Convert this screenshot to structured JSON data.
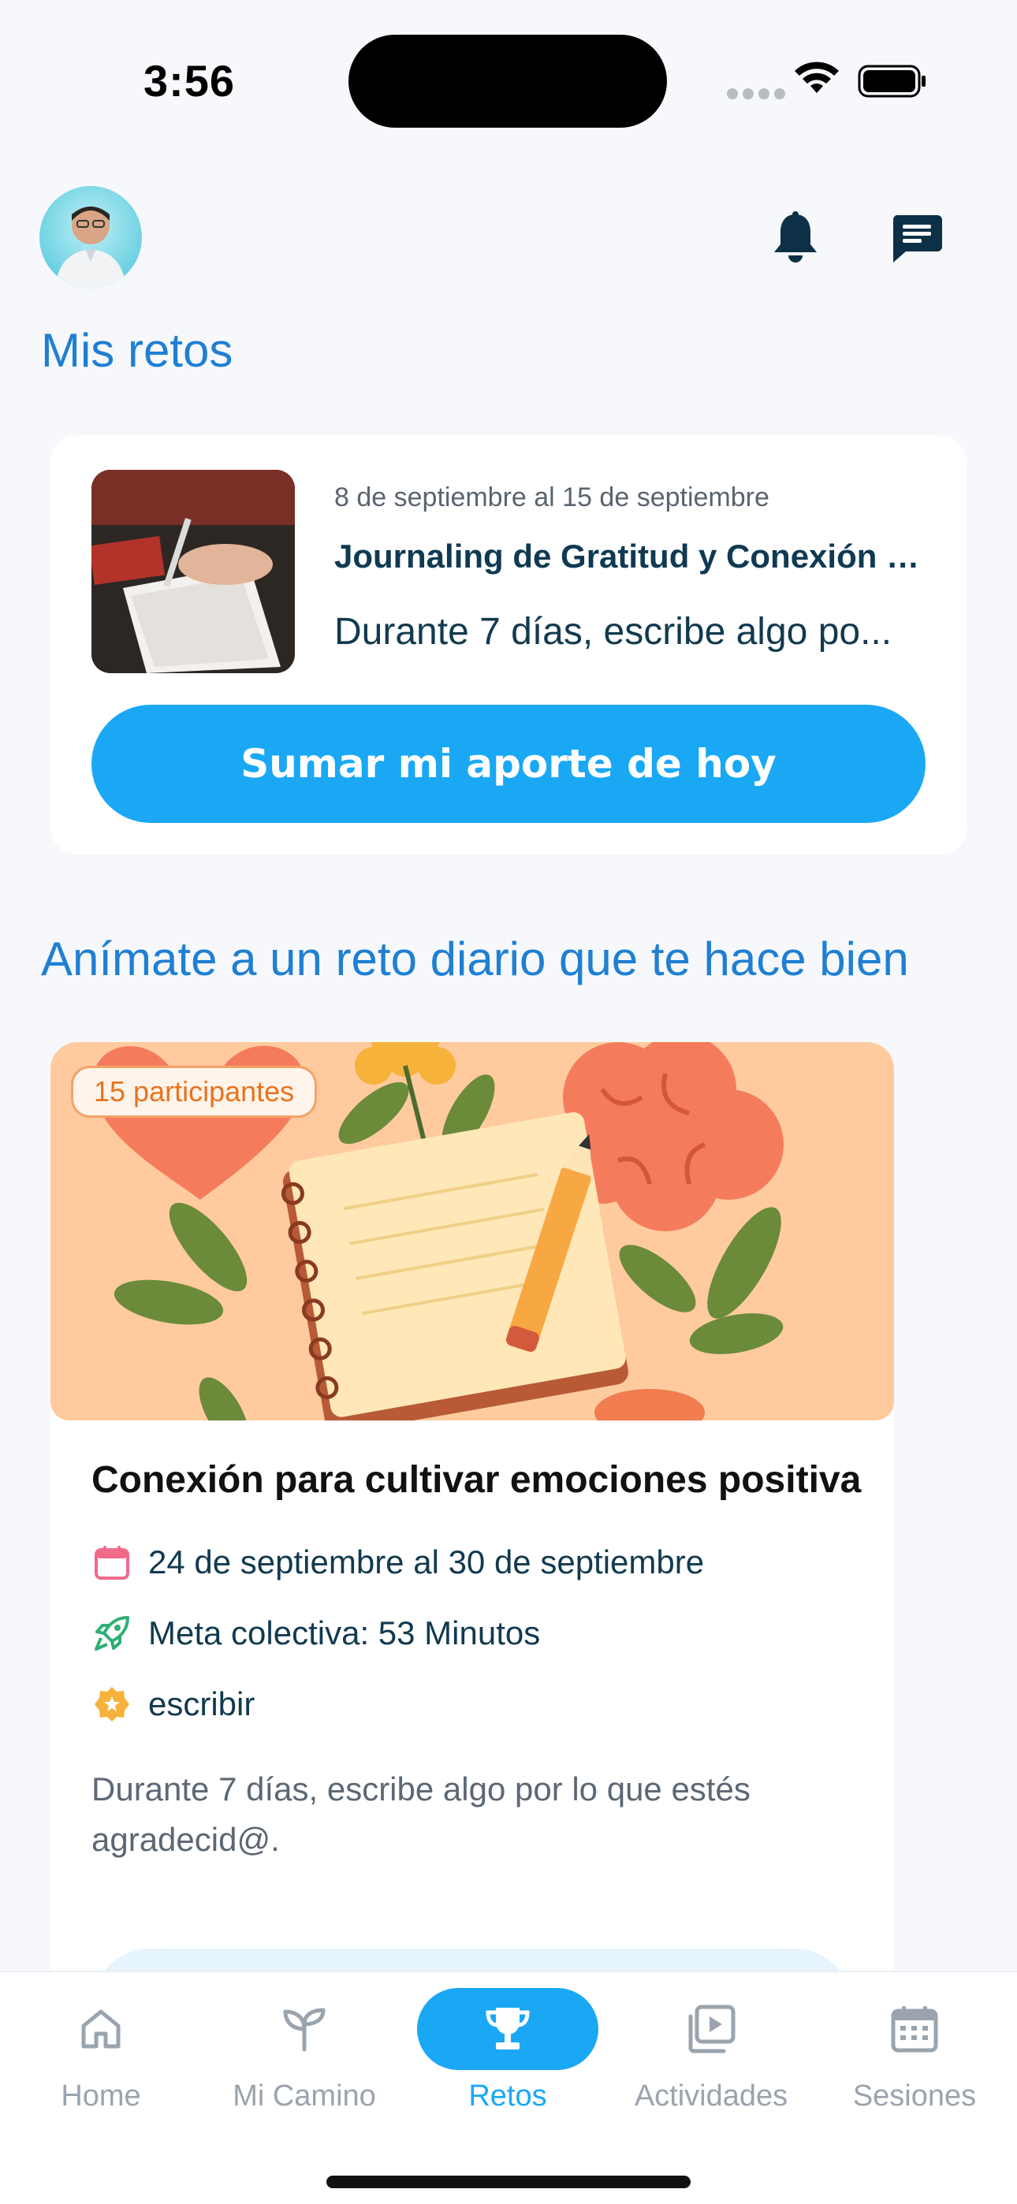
{
  "status_bar": {
    "time": "3:56"
  },
  "header": {
    "avatar_alt": "avatar",
    "notifications_icon": "bell-icon",
    "messages_icon": "chat-icon"
  },
  "my_challenges": {
    "title": "Mis retos",
    "card": {
      "date_range": "8 de septiembre al 15 de septiembre",
      "title": "Journaling de Gratitud y Conexión p...",
      "description": "Durante 7 días, escribe algo po...",
      "button_label": "Sumar mi aporte de hoy"
    }
  },
  "discover": {
    "title": "Anímate a un reto diario que te hace bien",
    "card": {
      "participants": "15 participantes",
      "title": "Conexión para cultivar emociones positiva",
      "date_range": "24 de septiembre al 30 de septiembre",
      "goal": "Meta colectiva: 53 Minutos",
      "activity": "escribir",
      "description": "Durante 7 días, escribe algo por lo que estés agradecid@."
    }
  },
  "tab_bar": {
    "tabs": [
      {
        "label": "Home",
        "icon": "home-icon",
        "active": false
      },
      {
        "label": "Mi Camino",
        "icon": "sprout-icon",
        "active": false
      },
      {
        "label": "Retos",
        "icon": "trophy-icon",
        "active": true
      },
      {
        "label": "Actividades",
        "icon": "video-library-icon",
        "active": false
      },
      {
        "label": "Sesiones",
        "icon": "calendar-icon",
        "active": false
      }
    ]
  },
  "colors": {
    "accent": "#1aa8f5",
    "section_title": "#1f7fd3",
    "badge_text": "#e7731f",
    "hero_background": "#ffcb9e"
  }
}
